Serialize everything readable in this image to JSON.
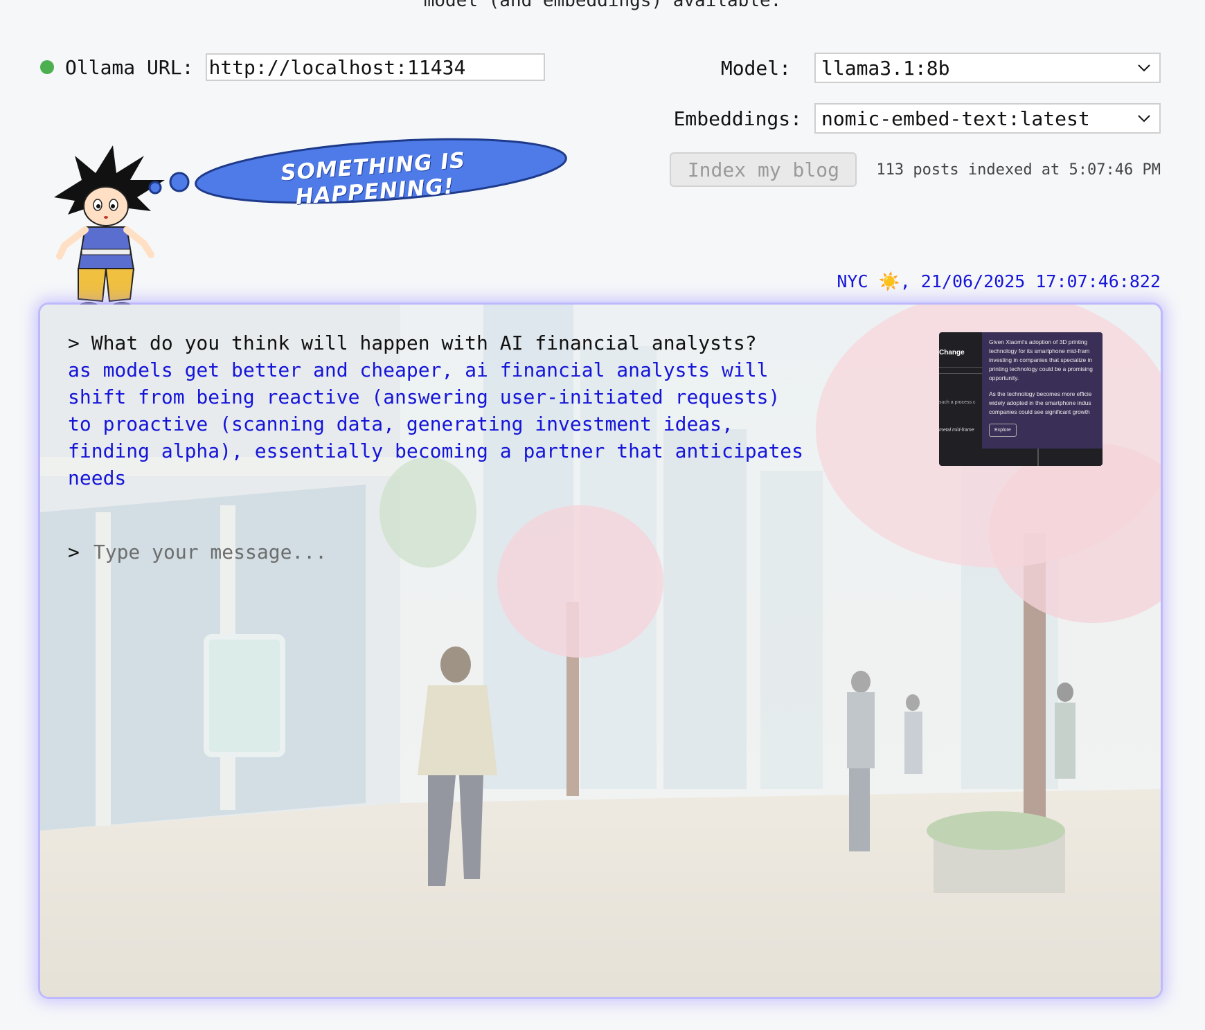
{
  "header": {
    "top_note": "model (and embeddings) available."
  },
  "connection": {
    "url_label": "Ollama URL:",
    "url_value": "http://localhost:11434",
    "status_color": "#4caf50"
  },
  "model": {
    "label": "Model:",
    "selected": "llama3.1:8b"
  },
  "embeddings": {
    "label": "Embeddings:",
    "selected": "nomic-embed-text:latest"
  },
  "index": {
    "button_label": "Index my blog",
    "status": "113 posts indexed at 5:07:46 PM"
  },
  "mascot": {
    "thought_text": "SOMETHING IS HAPPENING!"
  },
  "clock": {
    "text": "NYC ☀️, 21/06/2025 17:07:46:822"
  },
  "chat": {
    "question": "> What do you think will happen with AI financial analysts?",
    "answer": "as models get better and cheaper, ai financial analysts will\nshift from being reactive (answering user-initiated requests)\nto proactive (scanning data, generating investment ideas,\nfinding alpha), essentially becoming a partner that anticipates\nneeds",
    "prompt_symbol": ">",
    "input_placeholder": "Type your message...",
    "input_value": ""
  },
  "thumbnail": {
    "title": "Change",
    "small_text_1": "such a process c",
    "small_text_2": "metal mid-frame",
    "paragraph_1": "Given Xiaomi's adoption of 3D printing technology for its smartphone mid-fram investing in companies that specialize in printing technology could be a promising opportunity.",
    "paragraph_2": "As the technology becomes more efficie widely adopted in the smartphone indus companies could see significant growth",
    "button_label": "Explore"
  },
  "colors": {
    "accent_blue": "#1515d8",
    "panel_glow": "#a99bff",
    "bubble_fill": "#4f7be8"
  }
}
